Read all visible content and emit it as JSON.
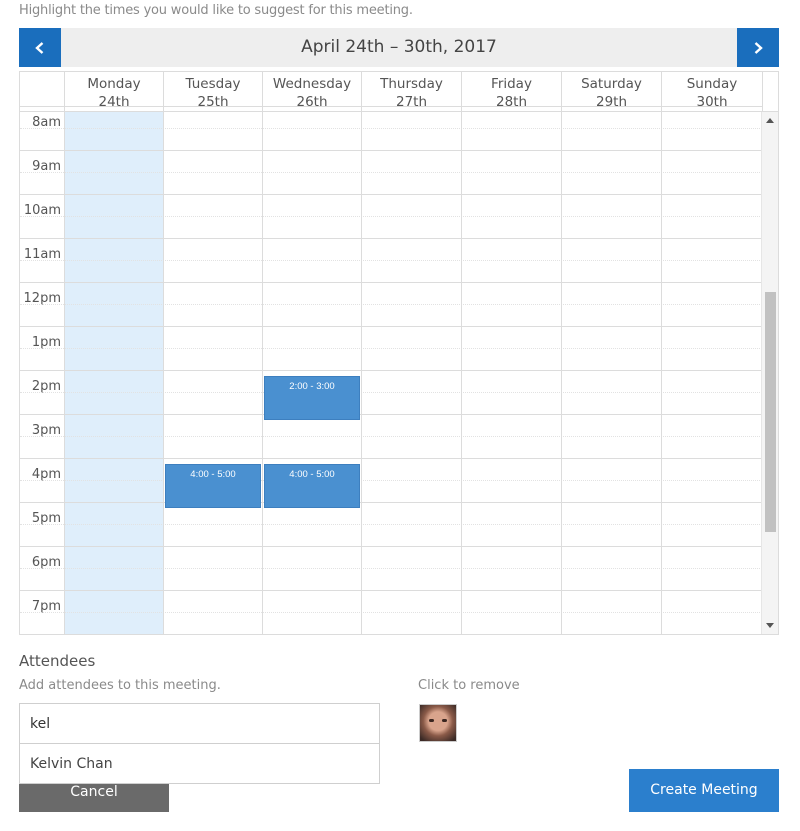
{
  "hint": "Highlight the times you would like to suggest for this meeting.",
  "calendar": {
    "range_title": "April 24th – 30th, 2017",
    "prev_icon": "chevron-left-icon",
    "next_icon": "chevron-right-icon",
    "days": [
      {
        "name": "Monday",
        "date": "24th"
      },
      {
        "name": "Tuesday",
        "date": "25th"
      },
      {
        "name": "Wednesday",
        "date": "26th"
      },
      {
        "name": "Thursday",
        "date": "27th"
      },
      {
        "name": "Friday",
        "date": "28th"
      },
      {
        "name": "Saturday",
        "date": "29th"
      },
      {
        "name": "Sunday",
        "date": "30th"
      }
    ],
    "times": [
      "8am",
      "9am",
      "10am",
      "11am",
      "12pm",
      "1pm",
      "2pm",
      "3pm",
      "4pm",
      "5pm",
      "6pm",
      "7pm"
    ],
    "selected_day": "Monday",
    "events": [
      {
        "day": "Wednesday",
        "label": "2:00 - 3:00"
      },
      {
        "day": "Tuesday",
        "label": "4:00 - 5:00"
      },
      {
        "day": "Wednesday",
        "label": "4:00 - 5:00"
      }
    ],
    "colors": {
      "accent": "#1a6ebd",
      "event": "#4a90d0",
      "selected": "#dfeefb"
    }
  },
  "attendees": {
    "title": "Attendees",
    "subtitle": "Add attendees to this meeting.",
    "input_value": "kel",
    "suggestion": "Kelvin Chan",
    "remove_hint": "Click to remove"
  },
  "actions": {
    "cancel_label": "Cancel",
    "create_label": "Create Meeting"
  }
}
